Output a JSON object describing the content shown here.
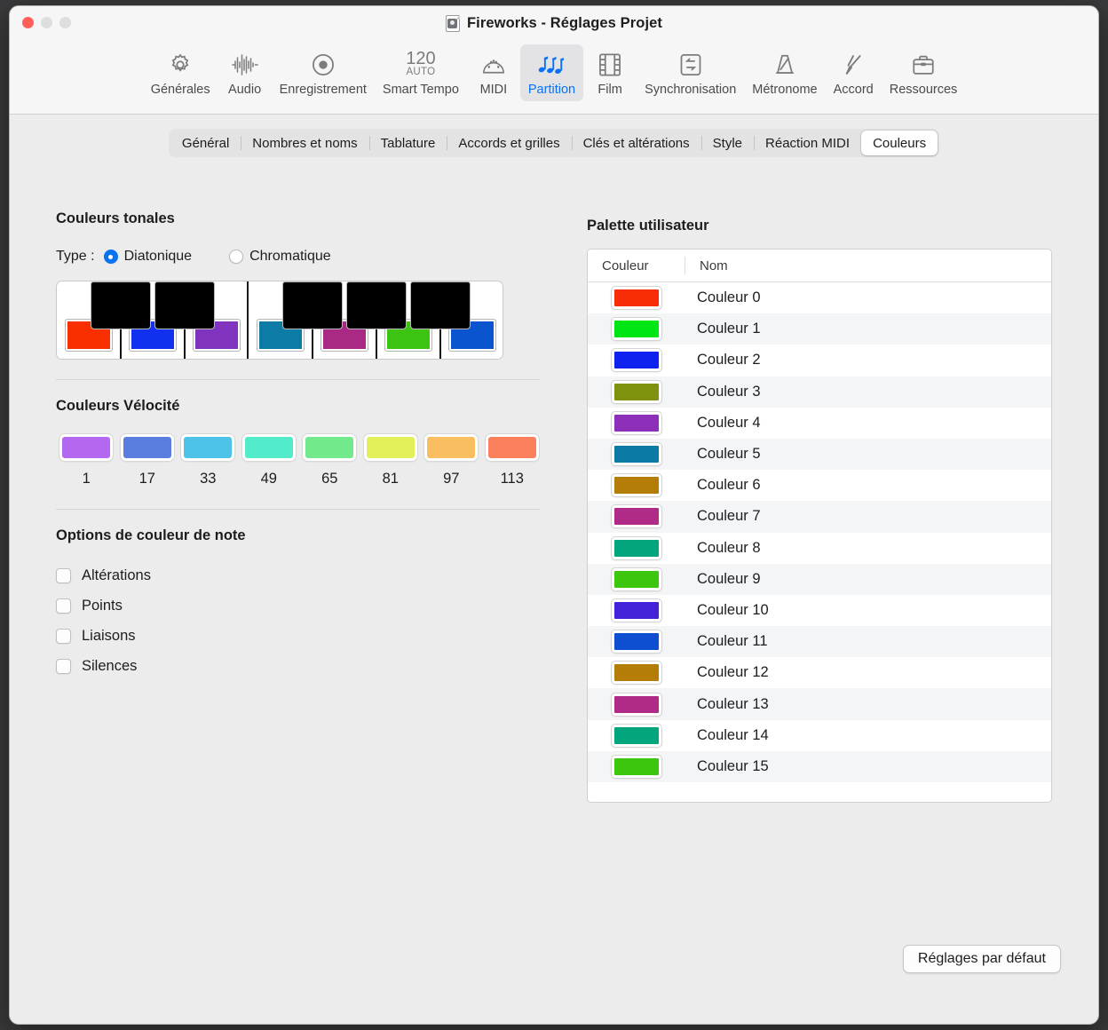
{
  "window": {
    "title": "Fireworks - Réglages Projet",
    "doc_icon": "logic-document-icon",
    "traffic": {
      "close": "close-button",
      "minimize": "minimize-button",
      "zoom": "zoom-button"
    }
  },
  "toolbar": {
    "items": [
      {
        "label": "Générales",
        "icon": "gear-icon",
        "active": false
      },
      {
        "label": "Audio",
        "icon": "waveform-icon",
        "active": false
      },
      {
        "label": "Enregistrement",
        "icon": "record-icon",
        "active": false
      },
      {
        "label": "Smart Tempo",
        "icon": "tempo-120-auto-icon",
        "active": false,
        "tempo": "120",
        "tempo_mode": "AUTO"
      },
      {
        "label": "MIDI",
        "icon": "midi-plug-icon",
        "active": false
      },
      {
        "label": "Partition",
        "icon": "music-notes-icon",
        "active": true
      },
      {
        "label": "Film",
        "icon": "film-strip-icon",
        "active": false
      },
      {
        "label": "Synchronisation",
        "icon": "sync-arrows-icon",
        "active": false
      },
      {
        "label": "Métronome",
        "icon": "metronome-icon",
        "active": false
      },
      {
        "label": "Accord",
        "icon": "tuning-fork-icon",
        "active": false
      },
      {
        "label": "Ressources",
        "icon": "briefcase-icon",
        "active": false
      }
    ]
  },
  "tabs": [
    {
      "label": "Général",
      "selected": false
    },
    {
      "label": "Nombres et noms",
      "selected": false
    },
    {
      "label": "Tablature",
      "selected": false
    },
    {
      "label": "Accords et grilles",
      "selected": false
    },
    {
      "label": "Clés et altérations",
      "selected": false
    },
    {
      "label": "Style",
      "selected": false
    },
    {
      "label": "Réaction MIDI",
      "selected": false
    },
    {
      "label": "Couleurs",
      "selected": true
    }
  ],
  "tonal_colors": {
    "title": "Couleurs tonales",
    "type_label": "Type :",
    "options": [
      {
        "label": "Diatonique",
        "selected": true
      },
      {
        "label": "Chromatique",
        "selected": false
      }
    ],
    "white_key_colors": [
      "#fa2f00",
      "#1130f0",
      "#8033bf",
      "#0c7ca6",
      "#a92a85",
      "#3dc412",
      "#0a54cf"
    ],
    "black_key_color": "#000000"
  },
  "velocity_colors": {
    "title": "Couleurs Vélocité",
    "swatches": [
      {
        "value": "1",
        "color": "#b468f0"
      },
      {
        "value": "17",
        "color": "#5a7ee0"
      },
      {
        "value": "33",
        "color": "#4ec3e8"
      },
      {
        "value": "49",
        "color": "#52ecca"
      },
      {
        "value": "65",
        "color": "#72ea8c"
      },
      {
        "value": "81",
        "color": "#e3f059"
      },
      {
        "value": "97",
        "color": "#f9be60"
      },
      {
        "value": "113",
        "color": "#fa7f5c"
      }
    ]
  },
  "note_color_options": {
    "title": "Options de couleur de note",
    "checkboxes": [
      {
        "label": "Altérations",
        "checked": false
      },
      {
        "label": "Points",
        "checked": false
      },
      {
        "label": "Liaisons",
        "checked": false
      },
      {
        "label": "Silences",
        "checked": false
      }
    ]
  },
  "user_palette": {
    "title": "Palette utilisateur",
    "columns": [
      "Couleur",
      "Nom"
    ],
    "rows": [
      {
        "name": "Couleur 0",
        "color": "#f82c06"
      },
      {
        "name": "Couleur 1",
        "color": "#00e514"
      },
      {
        "name": "Couleur 2",
        "color": "#0e21ee"
      },
      {
        "name": "Couleur 3",
        "color": "#80920d"
      },
      {
        "name": "Couleur 4",
        "color": "#8d2fb8"
      },
      {
        "name": "Couleur 5",
        "color": "#0b7ba6"
      },
      {
        "name": "Couleur 6",
        "color": "#b37d07"
      },
      {
        "name": "Couleur 7",
        "color": "#b02b87"
      },
      {
        "name": "Couleur 8",
        "color": "#03a57d"
      },
      {
        "name": "Couleur 9",
        "color": "#3cc60e"
      },
      {
        "name": "Couleur 10",
        "color": "#4422da"
      },
      {
        "name": "Couleur 11",
        "color": "#0e4ed0"
      },
      {
        "name": "Couleur 12",
        "color": "#b37d07"
      },
      {
        "name": "Couleur 13",
        "color": "#b02b87"
      },
      {
        "name": "Couleur 14",
        "color": "#03a57d"
      },
      {
        "name": "Couleur 15",
        "color": "#3cc60e"
      }
    ]
  },
  "footer": {
    "default_button": "Réglages par défaut"
  },
  "accent_color": "#0a72f5"
}
